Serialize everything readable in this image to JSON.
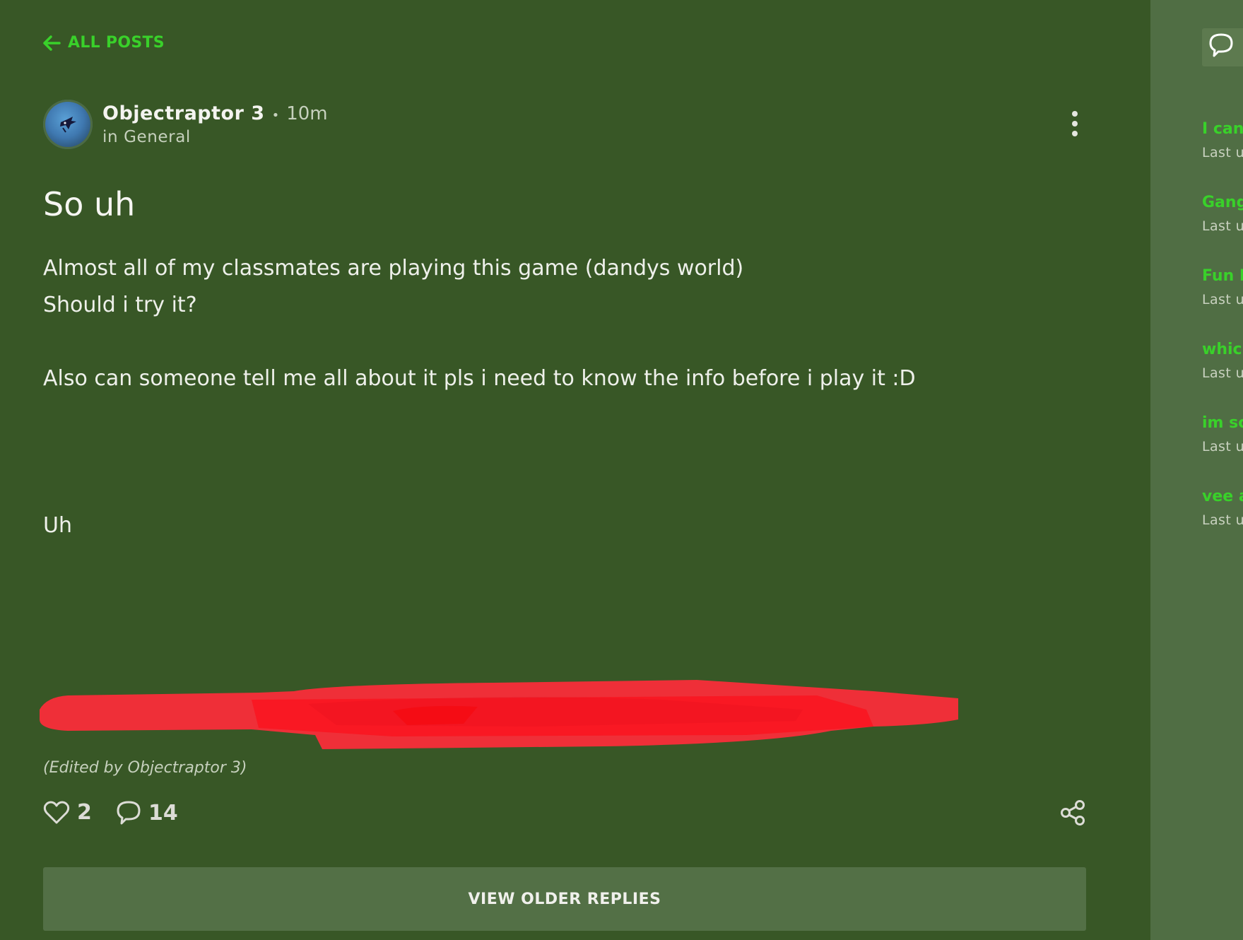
{
  "nav": {
    "back_label": "ALL POSTS"
  },
  "post": {
    "author": "Objectraptor 3",
    "separator": "•",
    "time": "10m",
    "category": "in General",
    "title": "So uh",
    "body": [
      "Almost all of my classmates are playing this game (dandys world)",
      "Should i try it?",
      "Also can someone tell me all about it pls i need to know the info before i play it :D",
      "Uh"
    ],
    "edited_note": "(Edited by Objectraptor 3)",
    "likes": "2",
    "comments": "14",
    "view_older_replies": "VIEW OLDER REPLIES"
  },
  "sidebar": {
    "items": [
      {
        "title": "I can",
        "meta": "Last u"
      },
      {
        "title": "Gang",
        "meta": "Last u"
      },
      {
        "title": "Fun F",
        "meta": "Last u"
      },
      {
        "title": "whic",
        "meta": "Last u"
      },
      {
        "title": "im so",
        "meta": "Last u"
      },
      {
        "title": "vee a",
        "meta": "Last u"
      }
    ]
  },
  "colors": {
    "background": "#385726",
    "sidebar": "#506e44",
    "accent": "#39d12a",
    "redaction": "#ff2b3a"
  },
  "icons": {
    "back": "arrow-left-icon",
    "more": "more-vertical-icon",
    "like": "heart-icon",
    "comment": "comment-icon",
    "share": "share-icon",
    "sidebar_header": "comment-icon"
  }
}
